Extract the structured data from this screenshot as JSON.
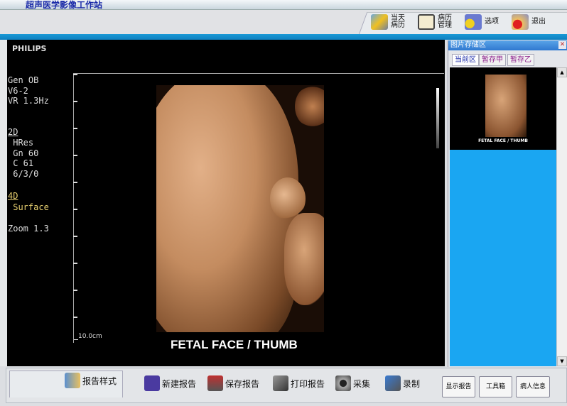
{
  "app": {
    "title": "超声医学影像工作站"
  },
  "top_toolbar": {
    "items": [
      {
        "label": "当天\n病历",
        "icon": "today-records-icon"
      },
      {
        "label": "病历\n管理",
        "icon": "book-icon"
      },
      {
        "label": "选项",
        "icon": "options-gear-icon"
      },
      {
        "label": "退出",
        "icon": "exit-icon"
      }
    ]
  },
  "viewer": {
    "brand": "PHILIPS",
    "info_block1": "Gen OB\nV6-2\nVR 1.3Hz",
    "mode_2d": "2D",
    "info_2d": " HRes\n Gn 60\n C 61\n 6/3/0",
    "mode_4d": "4D",
    "info_4d": " Surface",
    "zoom": "Zoom 1.3",
    "scale": "10.0cm",
    "caption": "FETAL  FACE / THUMB"
  },
  "image_store": {
    "title": "图片存储区",
    "tabs": [
      "当前区",
      "暂存甲",
      "暂存乙"
    ],
    "active_tab": "当前区",
    "thumbnail_caption": "FETAL FACE / THUMB"
  },
  "bottom_toolbar": {
    "report_style": "报告样式",
    "items": [
      {
        "label": "新建报告",
        "icon": "new-report-icon"
      },
      {
        "label": "保存报告",
        "icon": "save-report-icon"
      },
      {
        "label": "打印报告",
        "icon": "print-report-icon"
      },
      {
        "label": "采集",
        "icon": "camera-icon"
      },
      {
        "label": "录制",
        "icon": "video-camera-icon"
      }
    ],
    "buttons": [
      "显示报告",
      "工具箱",
      "病人信息"
    ]
  },
  "colors": {
    "accent_blue": "#1aa6f2",
    "title_text": "#1a2aa8"
  }
}
